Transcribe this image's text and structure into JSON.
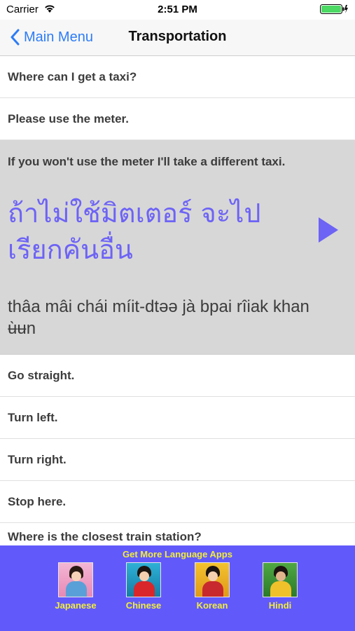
{
  "status_bar": {
    "carrier": "Carrier",
    "time": "2:51 PM",
    "wifi_icon": "wifi-icon",
    "battery_icon": "battery-icon"
  },
  "nav": {
    "back_label": "Main Menu",
    "title": "Transportation",
    "accent_color": "#2d7cf6"
  },
  "phrases": [
    "Where can I get a taxi?",
    "Please use the meter."
  ],
  "expanded": {
    "english": "If you won't use the meter I'll take a different taxi.",
    "thai": "ถ้าไม่ใช้มิตเตอร์ จะไปเรียกคันอื่น",
    "romanization": "thâa mâi chái míit-dtəə jà bpai rîiak khan ʉ̀ʉn",
    "play_icon": "play-icon",
    "thai_color": "#6d63f5"
  },
  "phrases_after": [
    "Go straight.",
    "Turn left.",
    "Turn right.",
    "Stop here."
  ],
  "partial_row": "Where is the closest train station?",
  "banner": {
    "title": "Get More Language Apps",
    "background": "#6259fb",
    "text_color": "#f2ee3a",
    "apps": [
      {
        "label": "Japanese",
        "icon": "japanese-app-icon"
      },
      {
        "label": "Chinese",
        "icon": "chinese-app-icon"
      },
      {
        "label": "Korean",
        "icon": "korean-app-icon"
      },
      {
        "label": "Hindi",
        "icon": "hindi-app-icon"
      }
    ]
  }
}
